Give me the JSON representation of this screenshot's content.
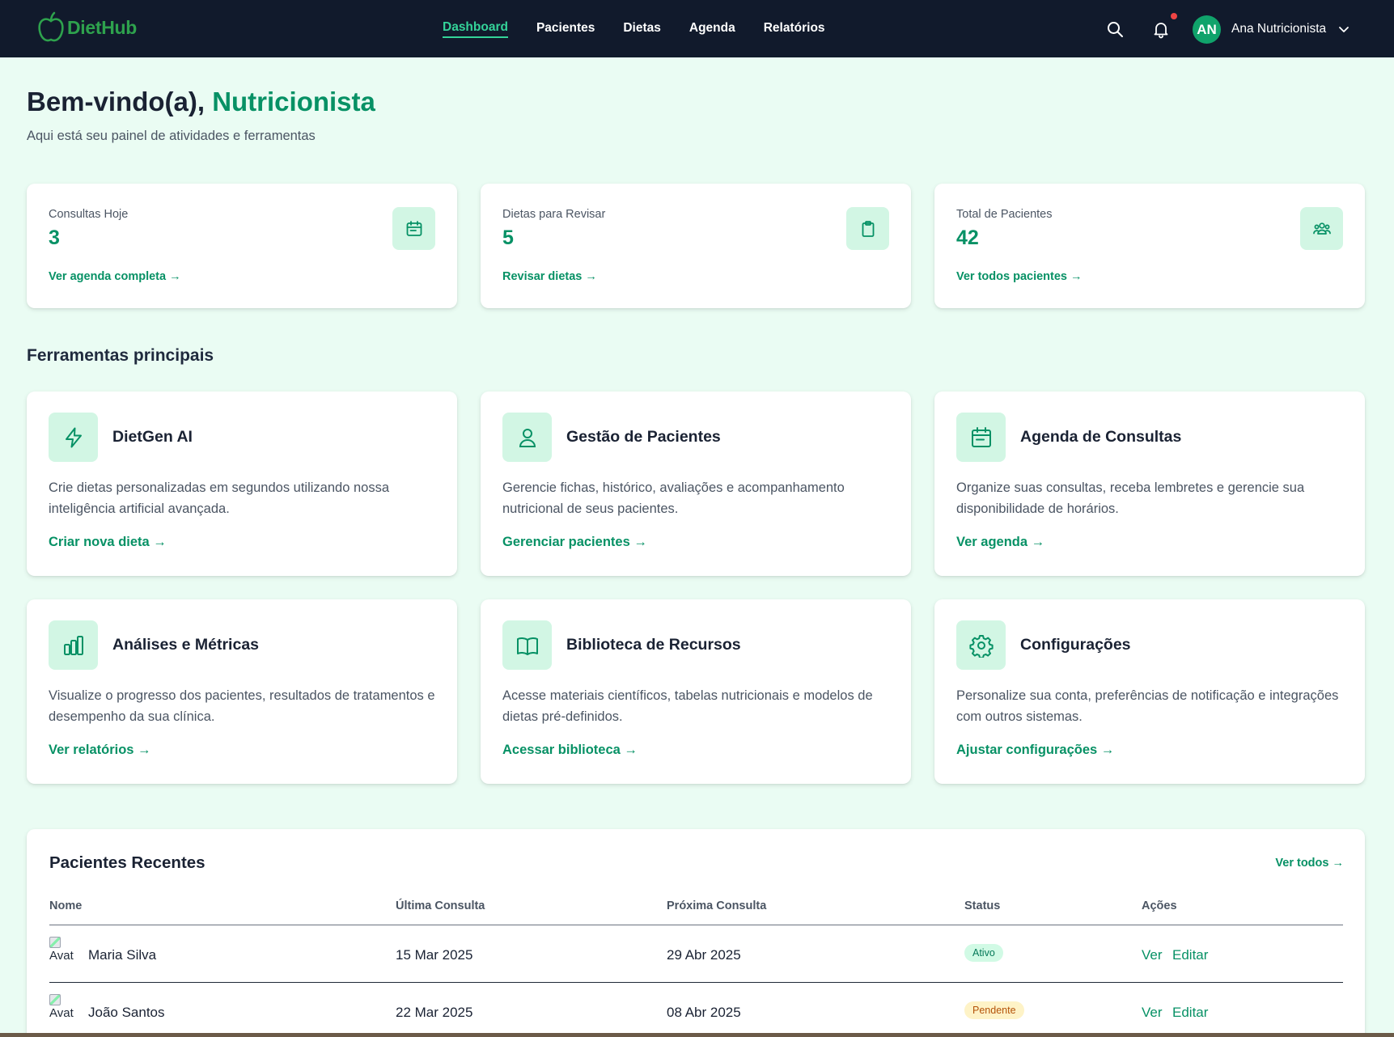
{
  "brand": {
    "name": "DietHub",
    "color": "#2ea24d"
  },
  "nav": {
    "links": [
      {
        "label": "Dashboard",
        "active": true
      },
      {
        "label": "Pacientes"
      },
      {
        "label": "Dietas"
      },
      {
        "label": "Agenda"
      },
      {
        "label": "Relatórios"
      }
    ],
    "user": {
      "initials": "AN",
      "name": "Ana Nutricionista"
    },
    "icons": [
      "search-icon",
      "bell-icon",
      "chevron-down-icon"
    ]
  },
  "header": {
    "greeting": "Bem-vindo(a),",
    "role": "Nutricionista",
    "subtitle": "Aqui está seu painel de atividades e ferramentas"
  },
  "stats": [
    {
      "label": "Consultas Hoje",
      "value": "3",
      "link": "Ver agenda completa →",
      "icon": "calendar-icon"
    },
    {
      "label": "Dietas para Revisar",
      "value": "5",
      "link": "Revisar dietas →",
      "icon": "clipboard-icon"
    },
    {
      "label": "Total de Pacientes",
      "value": "42",
      "link": "Ver todos pacientes →",
      "icon": "users-icon"
    }
  ],
  "tools_section_title": "Ferramentas principais",
  "tools": [
    {
      "title": "DietGen AI",
      "desc": "Crie dietas personalizadas em segundos utilizando nossa inteligência artificial avançada.",
      "link": "Criar nova dieta →",
      "icon": "lightning-icon"
    },
    {
      "title": "Gestão de Pacientes",
      "desc": "Gerencie fichas, histórico, avaliações e acompanhamento nutricional de seus pacientes.",
      "link": "Gerenciar pacientes →",
      "icon": "user-icon"
    },
    {
      "title": "Agenda de Consultas",
      "desc": "Organize suas consultas, receba lembretes e gerencie sua disponibilidade de horários.",
      "link": "Ver agenda →",
      "icon": "calendar-icon"
    },
    {
      "title": "Análises e Métricas",
      "desc": "Visualize o progresso dos pacientes, resultados de tratamentos e desempenho da sua clínica.",
      "link": "Ver relatórios →",
      "icon": "bar-chart-icon"
    },
    {
      "title": "Biblioteca de Recursos",
      "desc": "Acesse materiais científicos, tabelas nutricionais e modelos de dietas pré-definidos.",
      "link": "Acessar biblioteca →",
      "icon": "book-icon"
    },
    {
      "title": "Configurações",
      "desc": "Personalize sua conta, preferências de notificação e integrações com outros sistemas.",
      "link": "Ajustar configurações →",
      "icon": "gear-icon"
    }
  ],
  "recent": {
    "title": "Pacientes Recentes",
    "view_all": "Ver todos →",
    "columns": [
      "Nome",
      "Última Consulta",
      "Próxima Consulta",
      "Status",
      "Ações"
    ],
    "avatar_alt": "Avat",
    "rows": [
      {
        "name": "Maria Silva",
        "last": "15 Mar 2025",
        "next": "29 Abr 2025",
        "status": "Ativo",
        "status_kind": "ativo",
        "actions": [
          "Ver",
          "Editar"
        ]
      },
      {
        "name": "João Santos",
        "last": "22 Mar 2025",
        "next": "08 Abr 2025",
        "status": "Pendente",
        "status_kind": "pendente",
        "actions": [
          "Ver",
          "Editar"
        ]
      }
    ]
  },
  "colors": {
    "accent": "#079165",
    "nav_bg": "#111a2c",
    "page_bg": "#eafcf3",
    "icon_bg": "#d2f6e4",
    "notification_dot": "#ef4444"
  }
}
